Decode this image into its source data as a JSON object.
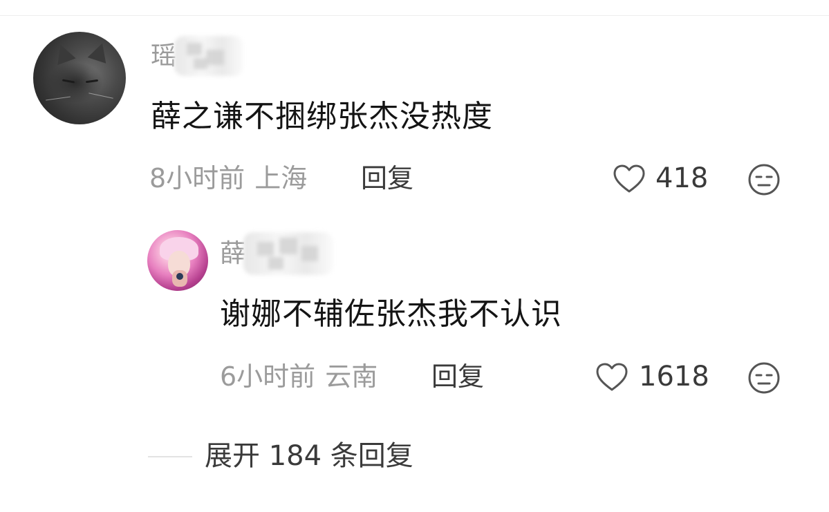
{
  "comments": [
    {
      "username": "瑶",
      "text": "薛之谦不捆绑张杰没热度",
      "time": "8小时前",
      "location": "上海",
      "reply_label": "回复",
      "likes": "418"
    }
  ],
  "replies": [
    {
      "username": "薛",
      "text": "谢娜不辅佐张杰我不认识",
      "time": "6小时前",
      "location": "云南",
      "reply_label": "回复",
      "likes": "1618"
    }
  ],
  "expand": {
    "label": "展开 184 条回复"
  },
  "icons": {
    "like": "heart-outline-icon",
    "dislike": "unamused-face-icon"
  },
  "colors": {
    "primary_text": "#141414",
    "secondary_text": "#9b9b9b",
    "action_text": "#3a3a3a"
  }
}
